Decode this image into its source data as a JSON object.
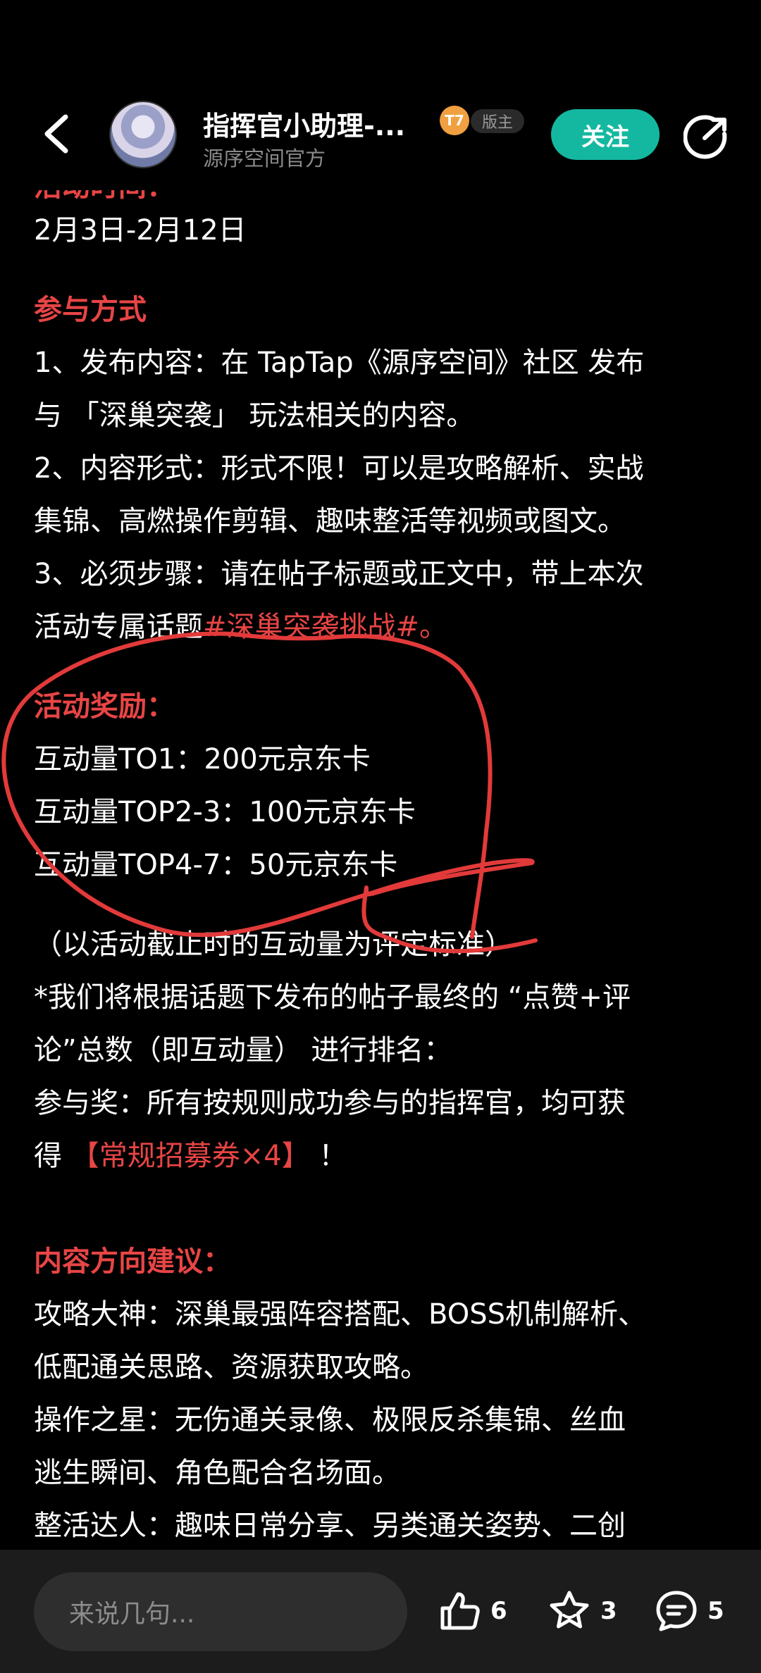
{
  "header": {
    "author_name": "指挥官小助理-...",
    "author_sub": "源序空间官方",
    "level_badge": "T7",
    "moderator_badge": "版主",
    "follow_label": "关注"
  },
  "post": {
    "cut_heading": "活动时间：",
    "date_range": "2月3日-2月12日",
    "how_heading": "参与方式",
    "how_1a": "1、发布内容：在 TapTap《源序空间》社区 发布",
    "how_1b": "与 「深巢突袭」 玩法相关的内容。",
    "how_2a": "2、内容形式：形式不限！可以是攻略解析、实战",
    "how_2b": "集锦、高燃操作剪辑、趣味整活等视频或图文。",
    "how_3a": "3、必须步骤：请在帖子标题或正文中，带上本次",
    "how_3b_prefix": "活动专属话题",
    "how_3b_tag": "#深巢突袭挑战#。",
    "reward_heading": "活动奖励：",
    "reward_1": "互动量TO1：200元京东卡",
    "reward_2": "互动量TOP2-3：100元京东卡",
    "reward_3": "互动量TOP4-7：50元京东卡",
    "note_1": "（以活动截止时的互动量为评定标准）",
    "note_2a": "*我们将根据话题下发布的帖子最终的 “点赞+评",
    "note_2b": "论”总数（即互动量） 进行排名：",
    "note_3a": "参与奖：所有按规则成功参与的指挥官，均可获",
    "note_3b_prefix": "得 ",
    "note_3b_red": "【常规招募券×4】",
    "note_3b_suffix": " ！",
    "suggest_heading": "内容方向建议：",
    "suggest_1a": "攻略大神：深巢最强阵容搭配、BOSS机制解析、",
    "suggest_1b": "低配通关思路、资源获取攻略。",
    "suggest_2a": "操作之星：无伤通关录像、极限反杀集锦、丝血",
    "suggest_2b": "逃生瞬间、角色配合名场面。",
    "suggest_3a": "整活达人：趣味日常分享、另类通关姿势、二创"
  },
  "bottom_bar": {
    "comment_placeholder": "来说几句...",
    "like_count": "6",
    "favorite_count": "3",
    "comment_count": "5"
  },
  "colors": {
    "accent_red": "#e84545",
    "follow_teal": "#14b8a0",
    "background": "#000000"
  }
}
